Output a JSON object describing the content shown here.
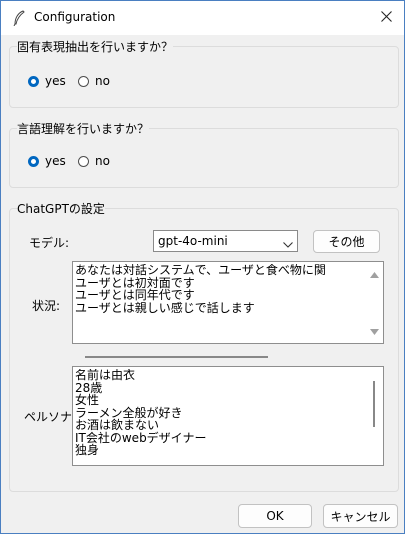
{
  "window": {
    "title": "Configuration"
  },
  "ner_group": {
    "label": "固有表現抽出を行いますか？",
    "options": [
      "yes",
      "no"
    ],
    "selected": "yes"
  },
  "nlu_group": {
    "label": "言語理解を行いますか？",
    "options": [
      "yes",
      "no"
    ],
    "selected": "yes"
  },
  "chatgpt_group": {
    "label": "ChatGPTの設定",
    "model_label": "モデル:",
    "model_value": "gpt-4o-mini",
    "other_button": "その他",
    "situation_label": "状況:",
    "situation_lines": [
      "あなたは対話システムで、ユーザと食べ物に関",
      "ユーザとは初対面です",
      "ユーザとは同年代です",
      "ユーザとは親しい感じで話します"
    ],
    "persona_label": "ペルソナ:",
    "persona_lines": [
      "名前は由衣",
      "28歳",
      "女性",
      "ラーメン全般が好き",
      "お酒は飲まない",
      "IT会社のwebデザイナー",
      "独身"
    ]
  },
  "footer": {
    "ok_button": "OK",
    "cancel_button": "キャンセル"
  },
  "icons": {
    "app": "feather-icon",
    "close": "close-icon"
  },
  "colors": {
    "accent": "#0067c0",
    "window_border": "#4a7fc1"
  }
}
